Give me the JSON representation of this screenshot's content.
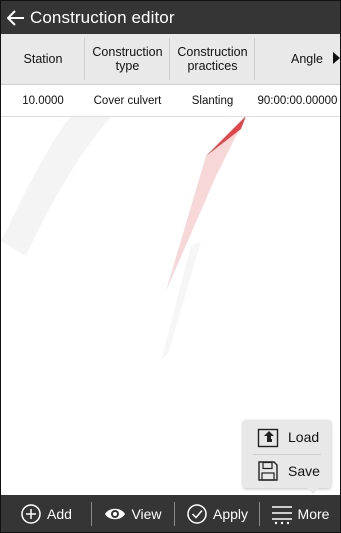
{
  "header": {
    "title": "Construction editor",
    "back_icon": "arrow-left-icon"
  },
  "table": {
    "columns": [
      "Station",
      "Construction type",
      "Construction practices",
      "Angle"
    ],
    "rows": [
      [
        "10.0000",
        "Cover culvert",
        "Slanting",
        "90:00:00.00000"
      ]
    ]
  },
  "popup_menu": {
    "items": [
      {
        "label": "Load",
        "icon": "load-icon"
      },
      {
        "label": "Save",
        "icon": "save-icon"
      }
    ]
  },
  "toolbar": {
    "add_label": "Add",
    "view_label": "View",
    "apply_label": "Apply",
    "more_label": "More"
  },
  "colors": {
    "bar_background": "#353535",
    "header_background": "#e9e9e9",
    "watermark_red": "#e3343a"
  }
}
